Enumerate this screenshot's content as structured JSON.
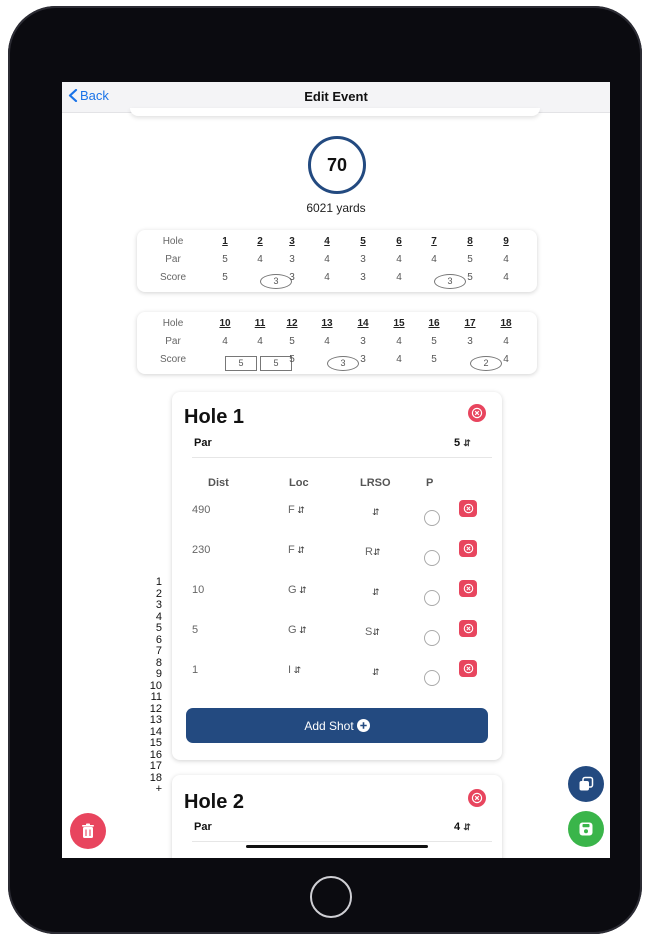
{
  "nav": {
    "back_label": "Back",
    "title": "Edit Event"
  },
  "summary": {
    "score": "70",
    "yards": "6021 yards"
  },
  "front_nine": {
    "hole_label": "Hole",
    "par_label": "Par",
    "score_label": "Score",
    "holes": [
      "1",
      "2",
      "3",
      "4",
      "5",
      "6",
      "7",
      "8",
      "9"
    ],
    "pars": [
      "5",
      "4",
      "3",
      "4",
      "3",
      "4",
      "4",
      "5",
      "4"
    ],
    "scores": [
      "5",
      "3",
      "3",
      "4",
      "3",
      "4",
      "3",
      "5",
      "4"
    ],
    "score_marks": [
      "",
      "circle",
      "",
      "",
      "",
      "",
      "circle",
      "",
      ""
    ]
  },
  "back_nine": {
    "hole_label": "Hole",
    "par_label": "Par",
    "score_label": "Score",
    "holes": [
      "10",
      "11",
      "12",
      "13",
      "14",
      "15",
      "16",
      "17",
      "18"
    ],
    "pars": [
      "4",
      "4",
      "5",
      "4",
      "3",
      "4",
      "5",
      "3",
      "4"
    ],
    "scores": [
      "5",
      "5",
      "5",
      "3",
      "3",
      "4",
      "5",
      "2",
      "4"
    ],
    "score_marks": [
      "square",
      "square",
      "",
      "circle",
      "",
      "",
      "",
      "circle",
      ""
    ]
  },
  "hole1": {
    "title": "Hole 1",
    "par_label": "Par",
    "par_value": "5",
    "columns": {
      "dist": "Dist",
      "loc": "Loc",
      "lrso": "LRSO",
      "p": "P"
    },
    "shots": [
      {
        "dist": "490",
        "loc": "F",
        "lrso": ""
      },
      {
        "dist": "230",
        "loc": "F",
        "lrso": "R"
      },
      {
        "dist": "10",
        "loc": "G",
        "lrso": ""
      },
      {
        "dist": "5",
        "loc": "G",
        "lrso": "S"
      },
      {
        "dist": "1",
        "loc": "I",
        "lrso": ""
      }
    ],
    "add_shot_label": "Add Shot"
  },
  "hole2": {
    "title": "Hole 2",
    "par_label": "Par",
    "par_value": "4"
  },
  "hole_index": [
    "1",
    "2",
    "3",
    "4",
    "5",
    "6",
    "7",
    "8",
    "9",
    "10",
    "11",
    "12",
    "13",
    "14",
    "15",
    "16",
    "17",
    "18",
    "+"
  ],
  "colors": {
    "primary": "#234a80",
    "danger": "#e8455e",
    "success": "#3ab54a",
    "link": "#1a73e8"
  },
  "icons": {
    "trash": "trash-icon",
    "copy": "copy-icon",
    "save": "save-icon"
  }
}
